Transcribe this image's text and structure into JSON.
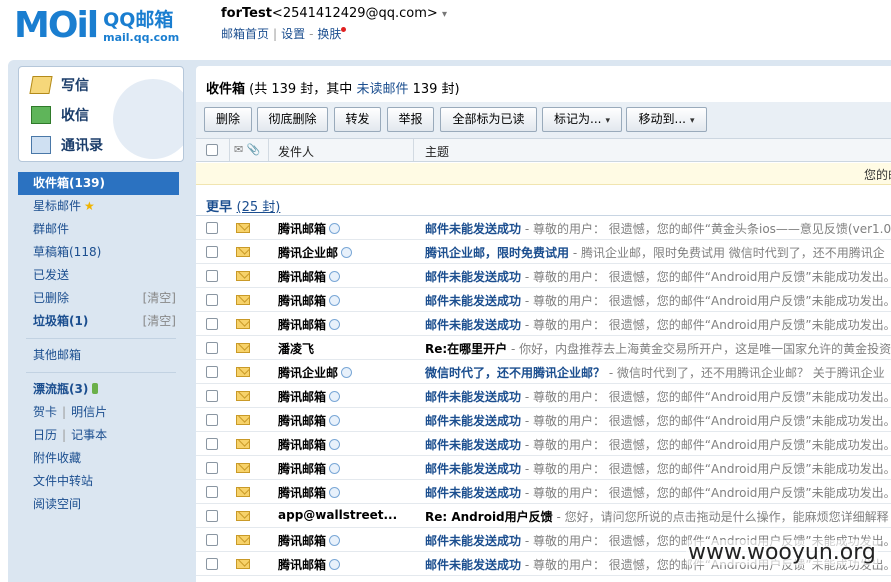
{
  "brand": {
    "logo_text": "MOil",
    "product": "QQ邮箱",
    "url": "mail.qq.com"
  },
  "user": {
    "name": "forTest",
    "email": "<2541412429@qq.com>",
    "caret": "▾"
  },
  "toplinks": {
    "home": "邮箱首页",
    "settings": "设置",
    "skin": "换肤"
  },
  "compose": {
    "write": "写信",
    "receive": "收信",
    "contacts": "通讯录"
  },
  "folders": {
    "inbox": "收件箱(139)",
    "starred": "星标邮件",
    "groups": "群邮件",
    "drafts": "草稿箱(118)",
    "sent": "已发送",
    "deleted": "已删除",
    "spam": "垃圾箱(1)",
    "clear": "[清空]",
    "other": "其他邮箱",
    "drift": "漂流瓶(3)",
    "cards": "贺卡",
    "postcards": "明信片",
    "calendar": "日历",
    "notes": "记事本",
    "attachments": "附件收藏",
    "transfer": "文件中转站",
    "reading": "阅读空间",
    "sep": "|"
  },
  "main": {
    "title": "收件箱",
    "summary_prefix": " (共 139 封，其中 ",
    "unread_label": "未读邮件",
    "summary_suffix": " 139 封)",
    "notice": "您的邮",
    "group_label": "更早",
    "group_count": "(25 封)"
  },
  "toolbar": {
    "delete": "删除",
    "purge": "彻底删除",
    "forward": "转发",
    "report": "举报",
    "mark_all": "全部标为已读",
    "mark_as": "标记为...",
    "move_to": "移动到...",
    "dd": "▾"
  },
  "columns": {
    "sender": "发件人",
    "subject": "主题",
    "icons": "✉ 📎"
  },
  "emails": [
    {
      "sender": "腾讯邮箱",
      "subject": "邮件未能发送成功",
      "preview": " - 尊敬的用户： 很遗憾，您的邮件“黄金头条ios——意见反馈(ver1.0",
      "dark": false
    },
    {
      "sender": "腾讯企业邮",
      "subject": "腾讯企业邮，限时免费试用",
      "preview": " - 腾讯企业邮，限时免费试用 微信时代到了，还不用腾讯企",
      "dark": false
    },
    {
      "sender": "腾讯邮箱",
      "subject": "邮件未能发送成功",
      "preview": " - 尊敬的用户： 很遗憾，您的邮件“Android用户反馈”未能成功发出。",
      "dark": false
    },
    {
      "sender": "腾讯邮箱",
      "subject": "邮件未能发送成功",
      "preview": " - 尊敬的用户： 很遗憾，您的邮件“Android用户反馈”未能成功发出。",
      "dark": false
    },
    {
      "sender": "腾讯邮箱",
      "subject": "邮件未能发送成功",
      "preview": " - 尊敬的用户： 很遗憾，您的邮件“Android用户反馈”未能成功发出。",
      "dark": false
    },
    {
      "sender": "潘凌飞",
      "subject": "Re:在哪里开户",
      "preview": " - 你好，内盘推荐去上海黄金交易所开户，这是唯一国家允许的黄金投资",
      "dark": true
    },
    {
      "sender": "腾讯企业邮",
      "subject": "微信时代了，还不用腾讯企业邮？",
      "preview": " - 微信时代到了，还不用腾讯企业邮？ 关于腾讯企业",
      "dark": false
    },
    {
      "sender": "腾讯邮箱",
      "subject": "邮件未能发送成功",
      "preview": " - 尊敬的用户： 很遗憾，您的邮件“Android用户反馈”未能成功发出。",
      "dark": false
    },
    {
      "sender": "腾讯邮箱",
      "subject": "邮件未能发送成功",
      "preview": " - 尊敬的用户： 很遗憾，您的邮件“Android用户反馈”未能成功发出。",
      "dark": false
    },
    {
      "sender": "腾讯邮箱",
      "subject": "邮件未能发送成功",
      "preview": " - 尊敬的用户： 很遗憾，您的邮件“Android用户反馈”未能成功发出。",
      "dark": false
    },
    {
      "sender": "腾讯邮箱",
      "subject": "邮件未能发送成功",
      "preview": " - 尊敬的用户： 很遗憾，您的邮件“Android用户反馈”未能成功发出。",
      "dark": false
    },
    {
      "sender": "腾讯邮箱",
      "subject": "邮件未能发送成功",
      "preview": " - 尊敬的用户： 很遗憾，您的邮件“Android用户反馈”未能成功发出。",
      "dark": false
    },
    {
      "sender": "app@wallstreet...",
      "subject": "Re: Android用户反馈",
      "preview": " - 您好，请问您所说的点击拖动是什么操作，能麻烦您详细解释",
      "dark": true
    },
    {
      "sender": "腾讯邮箱",
      "subject": "邮件未能发送成功",
      "preview": " - 尊敬的用户： 很遗憾，您的邮件“Android用户反馈”未能成功发出。",
      "dark": false
    },
    {
      "sender": "腾讯邮箱",
      "subject": "邮件未能发送成功",
      "preview": " - 尊敬的用户： 很遗憾，您的邮件“Android用户反馈”未能成功发出。",
      "dark": false
    }
  ],
  "watermark": "www.wooyun.org",
  "colors": {
    "brand_blue": "#1a7ed0",
    "link_blue": "#1b4e8f",
    "active_bg": "#2b72c1",
    "frame_bg": "#dbe6f1"
  }
}
